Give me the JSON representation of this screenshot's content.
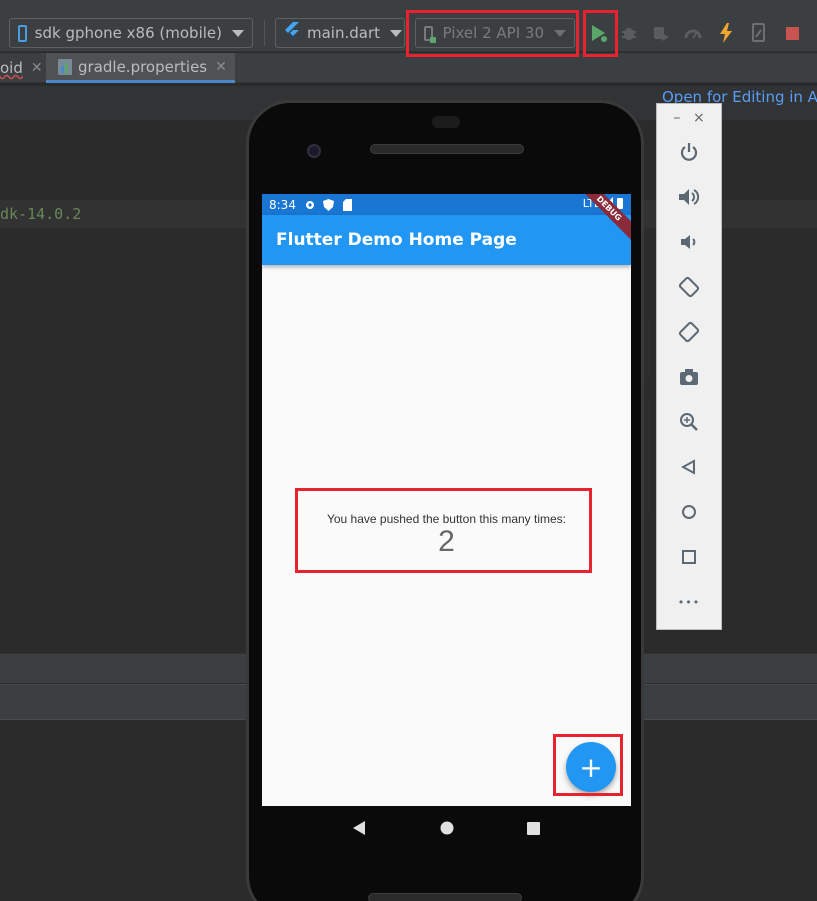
{
  "toolbar": {
    "device_selector": "sdk gphone x86 (mobile)",
    "run_config": "main.dart",
    "avd_selector": "Pixel 2 API 30"
  },
  "tabs": [
    {
      "label": "oid"
    },
    {
      "label": "gradle.properties"
    }
  ],
  "editor": {
    "code_fragment": "dk-14.0.2",
    "open_link": "Open for Editing in An"
  },
  "phone": {
    "status": {
      "time": "8:34",
      "network": "LTE"
    },
    "debug_banner": "DEBUG",
    "app_title": "Flutter Demo Home Page",
    "message": "You have pushed the button this many times:",
    "counter": "2",
    "fab_label": "+"
  },
  "emulator_panel": {
    "minimize": "–",
    "close": "×",
    "buttons": [
      "power-icon",
      "volume-up-icon",
      "volume-down-icon",
      "rotate-left-icon",
      "rotate-right-icon",
      "camera-icon",
      "zoom-icon",
      "back-icon",
      "home-icon",
      "overview-icon",
      "more-icon"
    ],
    "more_label": "•••"
  },
  "colors": {
    "highlight": "#e8232f",
    "app_bar": "#2196f3",
    "status_bar": "#1976d2",
    "run_green": "#59a869"
  }
}
